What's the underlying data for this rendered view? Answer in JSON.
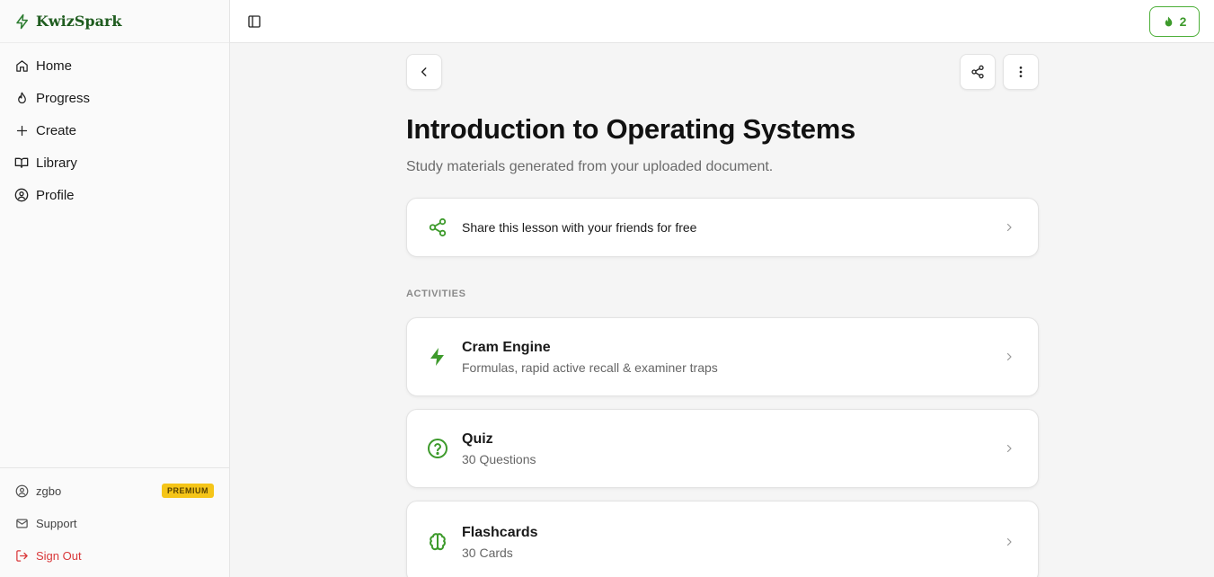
{
  "app": {
    "name": "KwizSpark"
  },
  "sidebar": {
    "items": [
      {
        "label": "Home",
        "icon": "home-icon"
      },
      {
        "label": "Progress",
        "icon": "flame-icon"
      },
      {
        "label": "Create",
        "icon": "plus-icon"
      },
      {
        "label": "Library",
        "icon": "book-icon"
      },
      {
        "label": "Profile",
        "icon": "user-circle-icon"
      }
    ],
    "user": {
      "name": "zgbo",
      "badge": "PREMIUM"
    },
    "support_label": "Support",
    "signout_label": "Sign Out"
  },
  "topbar": {
    "streak_count": "2"
  },
  "page": {
    "title": "Introduction to Operating Systems",
    "subtitle": "Study materials generated from your uploaded document.",
    "share_card": {
      "label": "Share this lesson with your friends for free"
    },
    "section_label": "ACTIVITIES",
    "activities": [
      {
        "title": "Cram Engine",
        "subtitle": "Formulas, rapid active recall & examiner traps",
        "icon": "lightning-icon"
      },
      {
        "title": "Quiz",
        "subtitle": "30 Questions",
        "icon": "question-circle-icon"
      },
      {
        "title": "Flashcards",
        "subtitle": "30 Cards",
        "icon": "brain-icon"
      }
    ]
  },
  "colors": {
    "accent_green": "#3d9a2b",
    "brand_green": "#1f5c1f",
    "premium_yellow": "#f5c518",
    "danger_red": "#d9383a"
  }
}
